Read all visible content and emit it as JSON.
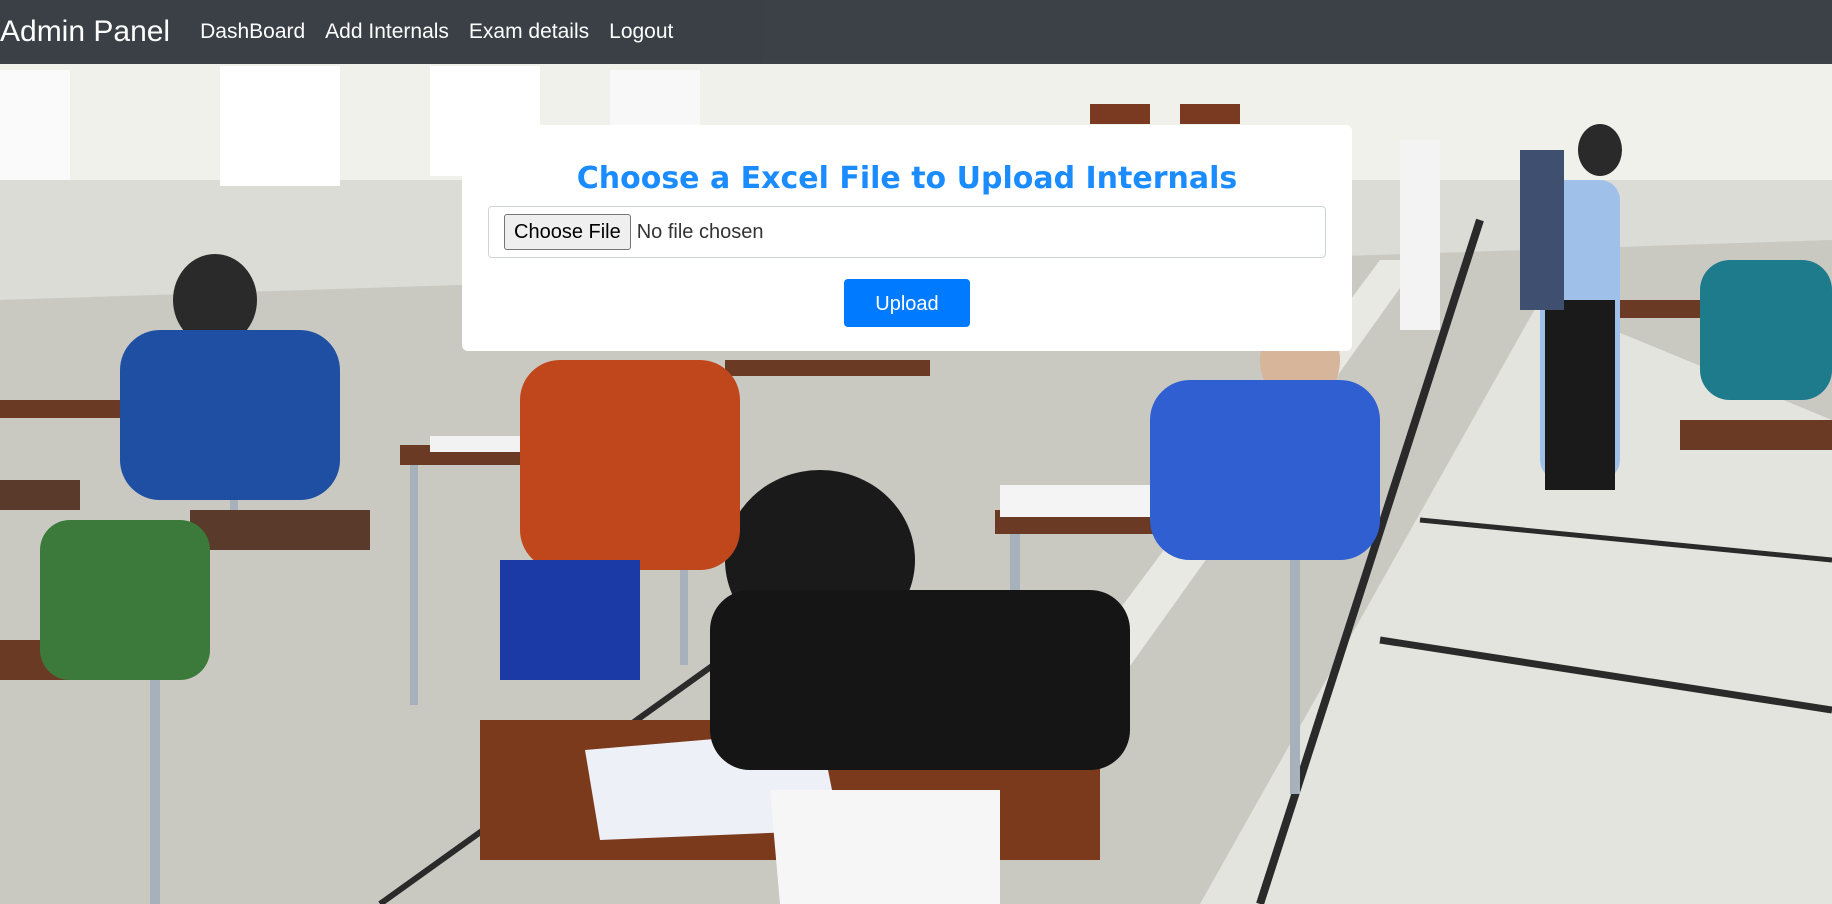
{
  "navbar": {
    "brand": "Admin Panel",
    "links": [
      {
        "label": "DashBoard"
      },
      {
        "label": "Add Internals"
      },
      {
        "label": "Exam details"
      },
      {
        "label": "Logout"
      }
    ]
  },
  "upload_card": {
    "title": "Choose a Excel File to Upload Internals",
    "file_button_label": "Choose File",
    "file_status": "No file chosen",
    "upload_label": "Upload"
  },
  "colors": {
    "navbar_bg": "#343a40",
    "title_color": "#1a8cff",
    "primary_button": "#007bff"
  },
  "background": {
    "description_icon": "exam-hall-photo"
  }
}
